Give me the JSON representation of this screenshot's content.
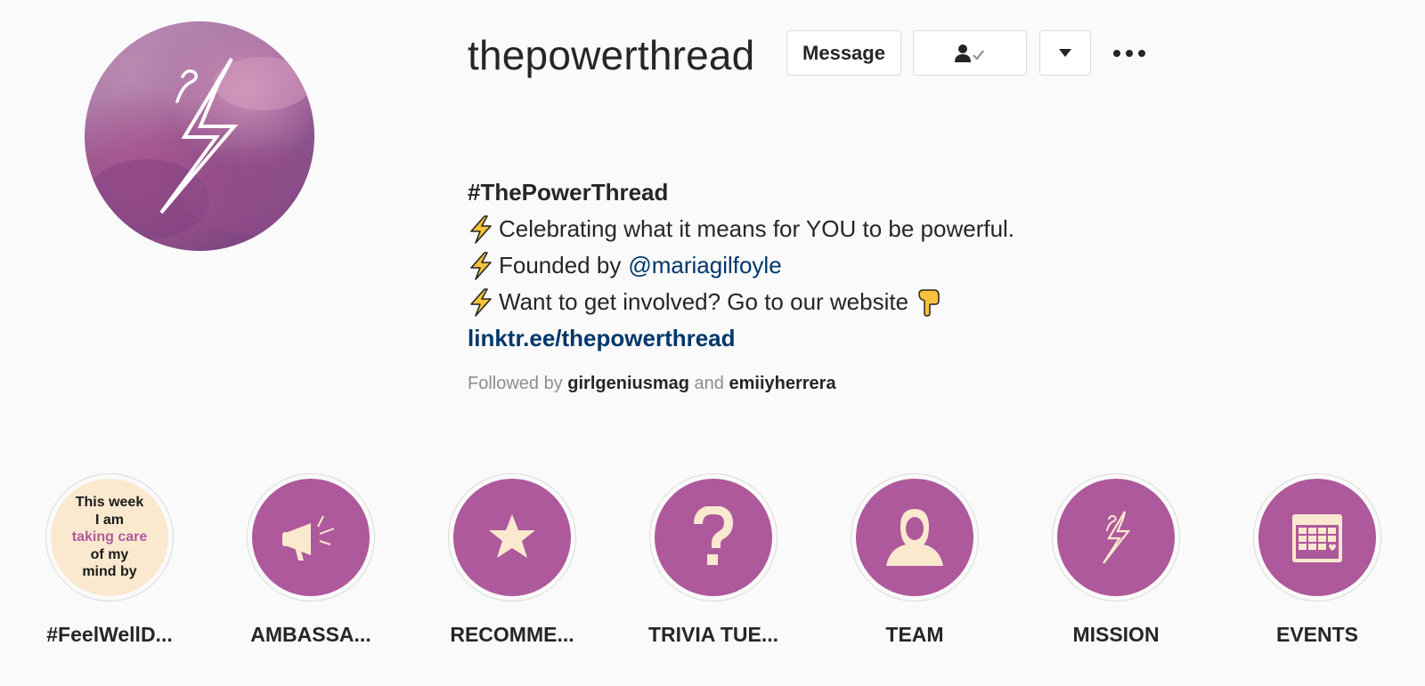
{
  "profile": {
    "username": "thepowerthread",
    "message_label": "Message",
    "following_icon": "person-check-icon",
    "dropdown_icon": "caret-down-icon",
    "more_icon": "ellipsis-icon"
  },
  "bio": {
    "title": "#ThePowerThread",
    "line1": "Celebrating what it means for YOU to be powerful.",
    "line2_prefix": "Founded by",
    "line2_mention": "@mariagilfoyle",
    "line3": "Want to get involved? Go to our website",
    "link": "linktr.ee/thepowerthread",
    "bullet_icon": "lightning-bolt-icon",
    "pointing_icon": "pointing-down-hand-icon"
  },
  "followed_by": {
    "prefix": "Followed by",
    "user1": "girlgeniusmag",
    "conjunction": "and",
    "user2": "emiiyherrera"
  },
  "highlights": [
    {
      "label": "#FeelWellD...",
      "icon": "text-card",
      "card_text": [
        "This week",
        "I am",
        "taking care",
        "of my",
        "mind by"
      ]
    },
    {
      "label": "AMBASSA...",
      "icon": "megaphone-icon"
    },
    {
      "label": "RECOMME...",
      "icon": "star-icon"
    },
    {
      "label": "TRIVIA TUE...",
      "icon": "question-mark-icon"
    },
    {
      "label": "TEAM",
      "icon": "person-icon"
    },
    {
      "label": "MISSION",
      "icon": "lightning-bolt-icon"
    },
    {
      "label": "EVENTS",
      "icon": "calendar-icon"
    }
  ],
  "colors": {
    "highlight_bg": "#ae599b",
    "highlight_icon": "#fbe9cf",
    "link": "#00376b",
    "bolt_yellow": "#f7c23b"
  }
}
